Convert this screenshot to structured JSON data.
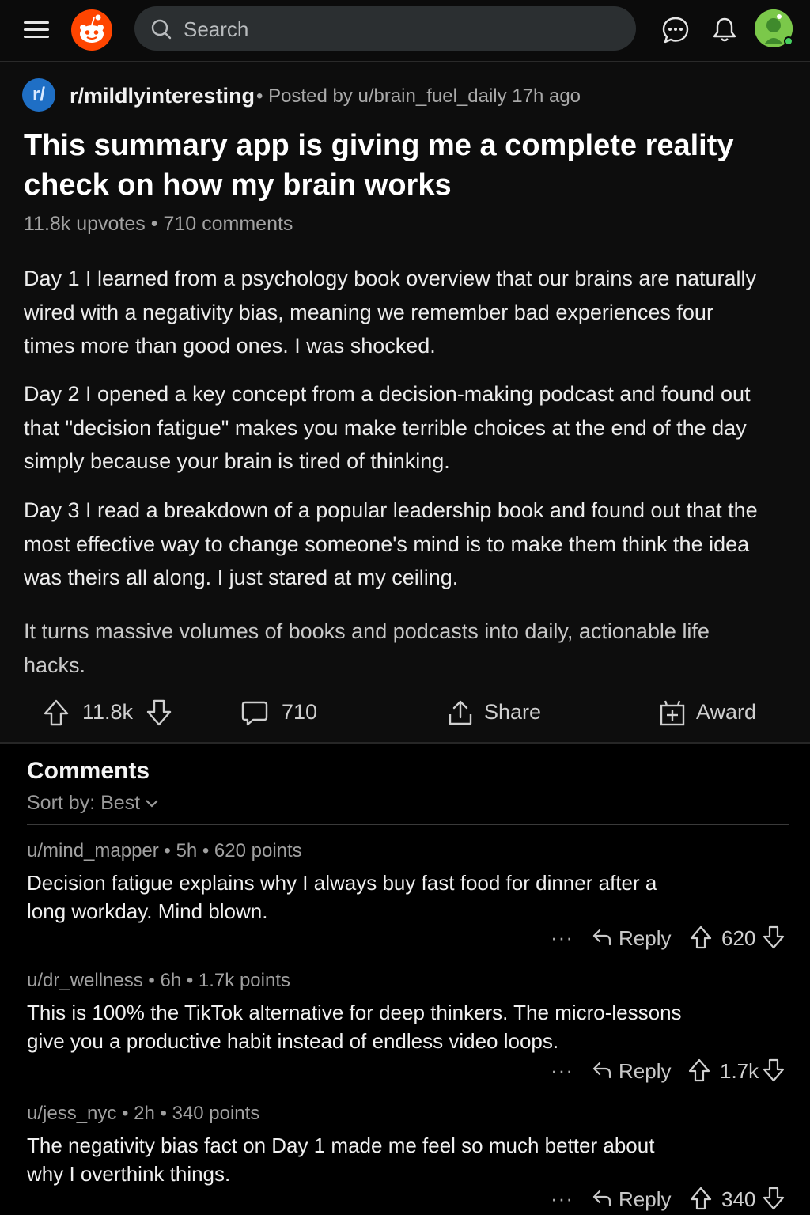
{
  "header": {
    "search_placeholder": "Search",
    "icons": [
      "menu-icon",
      "reddit-logo",
      "search-icon",
      "chat-icon",
      "bell-icon",
      "avatar"
    ]
  },
  "post": {
    "subreddit_icon_text": "r/",
    "subreddit": "r/mildlyinteresting",
    "posted_by": "• Posted by u/brain_fuel_daily 17h ago",
    "title": "This summary app is giving me a complete reality check on how my brain works",
    "stats": "11.8k upvotes • 710 comments",
    "paragraphs": [
      "Day 1 I learned from a psychology book overview that our brains are naturally wired with a negativity bias, meaning we remember bad experiences four times more than good ones. I was shocked.",
      "Day 2 I opened a key concept from a decision-making podcast and found out that \"decision fatigue\" makes you make terrible choices at the end of the day simply because your brain is tired of thinking.",
      "Day 3 I read a breakdown of a popular leadership book and found out that the most effective way to change someone's mind is to make them think the idea was theirs all along. I just stared at my ceiling.",
      "It turns massive volumes of books and podcasts into daily, actionable life hacks."
    ],
    "actions": {
      "votes": "11.8k",
      "comments": "710",
      "share": "Share",
      "award": "Award"
    }
  },
  "comments_section": {
    "heading": "Comments",
    "sort_label": "Sort by: Best",
    "items": [
      {
        "meta": "u/mind_mapper • 5h • 620 points",
        "body": "Decision fatigue explains why I always buy fast food for dinner after a long workday. Mind blown.",
        "more": "···",
        "reply": "Reply",
        "score": "620"
      },
      {
        "meta": "u/dr_wellness • 6h • 1.7k points",
        "body": "This is 100% the TikTok alternative for deep thinkers. The micro-lessons give you a productive habit instead of endless video loops.",
        "more": "···",
        "reply": "Reply",
        "score": "1.7k"
      },
      {
        "meta": "u/jess_nyc • 2h • 340 points",
        "body": "The negativity bias fact on Day 1 made me feel so much better about why I overthink things.",
        "more": "···",
        "reply": "Reply",
        "score": "340"
      }
    ]
  },
  "colors": {
    "brand": "#ff4500",
    "subreddit_icon": "#1f6fc5",
    "background": "#000000",
    "search_bg": "#2b2f31",
    "online_dot": "#46d160"
  }
}
